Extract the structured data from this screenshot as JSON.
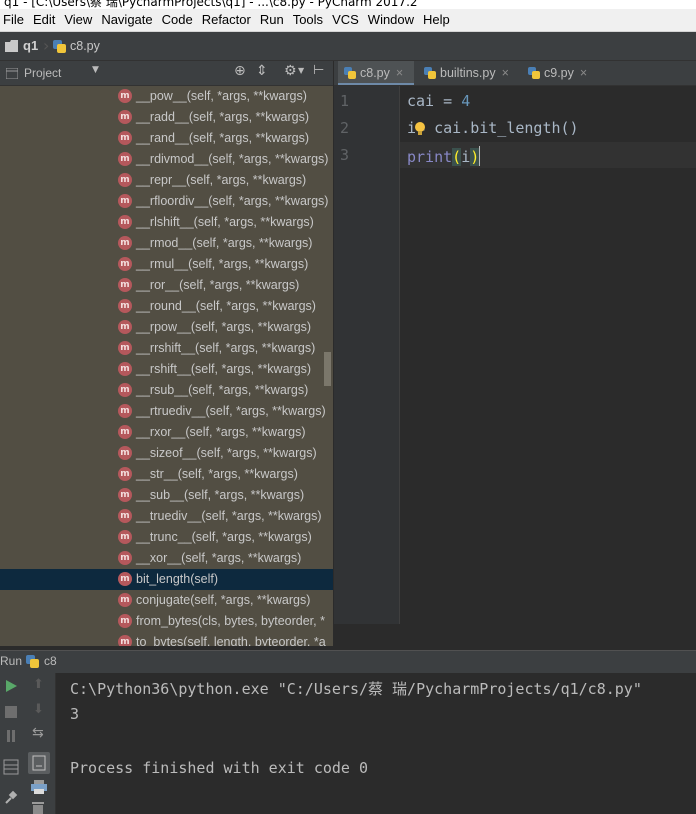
{
  "window": {
    "title": "q1 - [C:\\Users\\蔡 瑞\\PycharmProjects\\q1] - ...\\c8.py - PyCharm 2017.2"
  },
  "menu": [
    "File",
    "Edit",
    "View",
    "Navigate",
    "Code",
    "Refactor",
    "Run",
    "Tools",
    "VCS",
    "Window",
    "Help"
  ],
  "breadcrumb": {
    "project": "q1",
    "file": "c8.py"
  },
  "project_panel": {
    "label": "Project",
    "items": [
      "__pow__(self, *args, **kwargs)",
      "__radd__(self, *args, **kwargs)",
      "__rand__(self, *args, **kwargs)",
      "__rdivmod__(self, *args, **kwargs)",
      "__repr__(self, *args, **kwargs)",
      "__rfloordiv__(self, *args, **kwargs)",
      "__rlshift__(self, *args, **kwargs)",
      "__rmod__(self, *args, **kwargs)",
      "__rmul__(self, *args, **kwargs)",
      "__ror__(self, *args, **kwargs)",
      "__round__(self, *args, **kwargs)",
      "__rpow__(self, *args, **kwargs)",
      "__rrshift__(self, *args, **kwargs)",
      "__rshift__(self, *args, **kwargs)",
      "__rsub__(self, *args, **kwargs)",
      "__rtruediv__(self, *args, **kwargs)",
      "__rxor__(self, *args, **kwargs)",
      "__sizeof__(self, *args, **kwargs)",
      "__str__(self, *args, **kwargs)",
      "__sub__(self, *args, **kwargs)",
      "__truediv__(self, *args, **kwargs)",
      "__trunc__(self, *args, **kwargs)",
      "__xor__(self, *args, **kwargs)",
      "bit_length(self)",
      "conjugate(self, *args, **kwargs)",
      "from_bytes(cls, bytes, byteorder, *",
      "to_bytes(self, length, byteorder, *a"
    ],
    "selected_index": 23,
    "method_icon_letter": "m"
  },
  "editor": {
    "tabs": [
      "c8.py",
      "builtins.py",
      "c9.py"
    ],
    "active_tab": 0,
    "line_numbers": [
      "1",
      "2",
      "3"
    ],
    "lines": {
      "l1": {
        "var": "cai",
        "op": " = ",
        "num": "4"
      },
      "l2": {
        "a": "i",
        "b": "= cai.bit_length()"
      },
      "l3": {
        "fn": "print",
        "open": "(",
        "arg": "i",
        "close": ")"
      }
    }
  },
  "run_panel": {
    "label": "Run",
    "config": "c8",
    "output": [
      "C:\\Python36\\python.exe \"C:/Users/蔡 瑞/PycharmProjects/q1/c8.py\"",
      "3",
      "",
      "Process finished with exit code 0"
    ]
  },
  "colors": {
    "tree_bg": "#524e43",
    "selection": "#0d293e",
    "keyword_builtin": "#8888c6",
    "number": "#6897bb",
    "run_green": "#59a869"
  }
}
